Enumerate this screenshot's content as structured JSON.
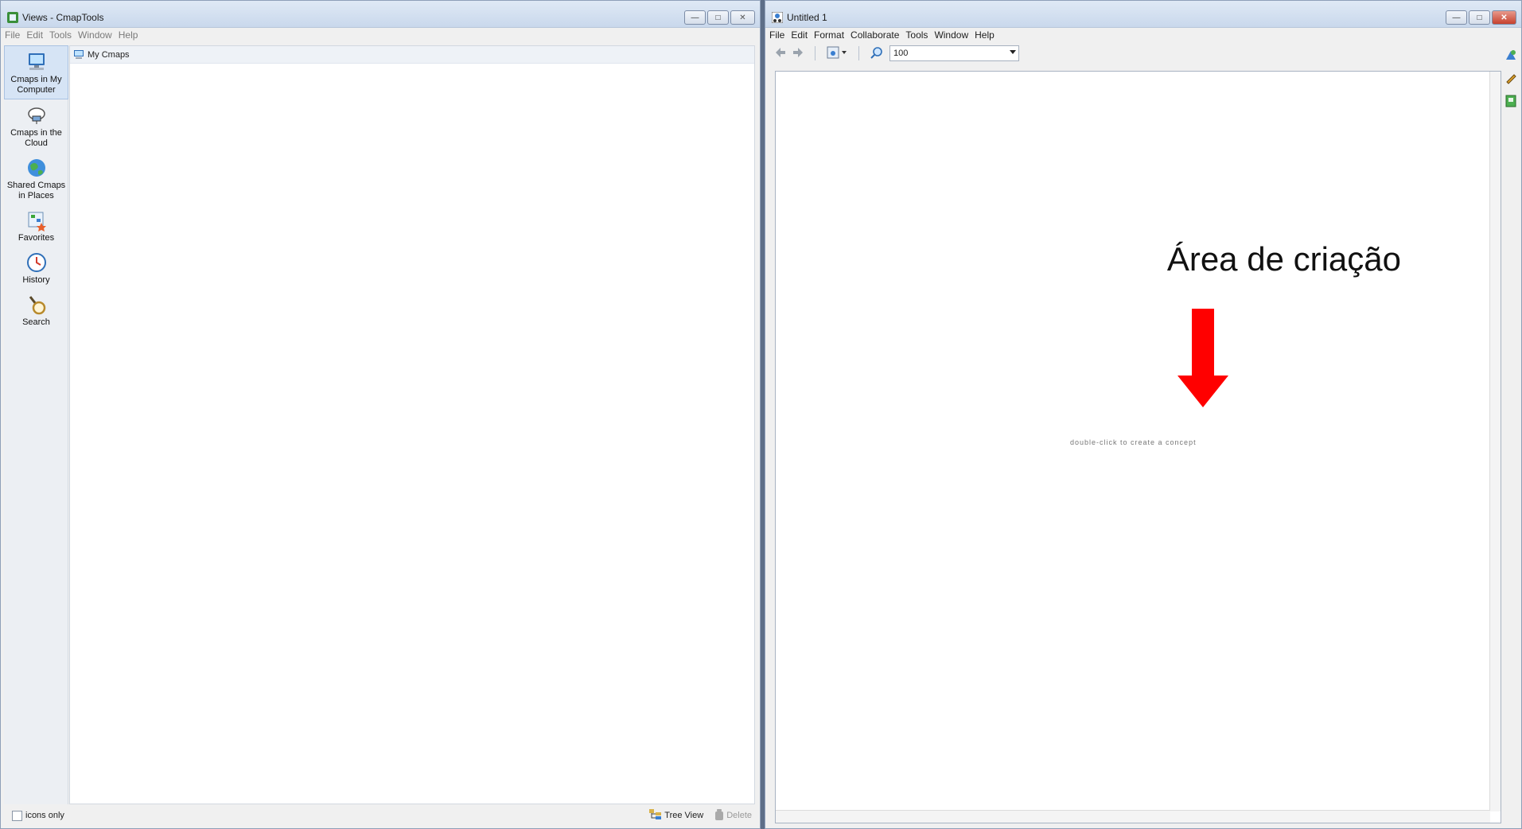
{
  "left_window": {
    "title": "Views - CmapTools",
    "menu": [
      "File",
      "Edit",
      "Tools",
      "Window",
      "Help"
    ],
    "sidebar": [
      {
        "label": "Cmaps in My Computer",
        "icon": "computer-icon",
        "active": true
      },
      {
        "label": "Cmaps in the Cloud",
        "icon": "cloud-icon",
        "active": false
      },
      {
        "label": "Shared Cmaps in Places",
        "icon": "globe-icon",
        "active": false
      },
      {
        "label": "Favorites",
        "icon": "favorites-icon",
        "active": false
      },
      {
        "label": "History",
        "icon": "history-icon",
        "active": false
      },
      {
        "label": "Search",
        "icon": "search-icon",
        "active": false
      }
    ],
    "folder_root": "My Cmaps",
    "footer": {
      "icons_only_label": "icons only",
      "tree_view_label": "Tree View",
      "delete_label": "Delete"
    }
  },
  "right_window": {
    "title": "Untitled 1",
    "menu": [
      "File",
      "Edit",
      "Format",
      "Collaborate",
      "Tools",
      "Window",
      "Help"
    ],
    "zoom_value": "100",
    "canvas": {
      "annotation_title": "Área de criação",
      "hint_text": "double-click to create a concept"
    }
  },
  "colors": {
    "arrow": "#ff0000",
    "titlebar": "#c9d8ec"
  }
}
